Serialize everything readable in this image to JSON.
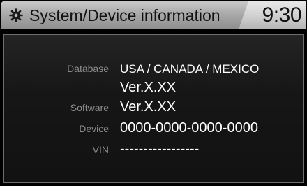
{
  "header": {
    "title": "System/Device information",
    "icon": "gear-icon",
    "clock": "9:30"
  },
  "info": {
    "database_label": "Database",
    "database_region": "USA / CANADA / MEXICO",
    "database_version": "Ver.X.XX",
    "software_label": "Software",
    "software_version": "Ver.X.XX",
    "device_label": "Device",
    "device_id": "0000-0000-0000-0000",
    "vin_label": "VIN",
    "vin_value": "-----------------"
  },
  "colors": {
    "header_bg": "#a9a9a9",
    "panel_bg": "#161616",
    "label_text": "#8c8c8c",
    "value_text": "#ffffff"
  }
}
